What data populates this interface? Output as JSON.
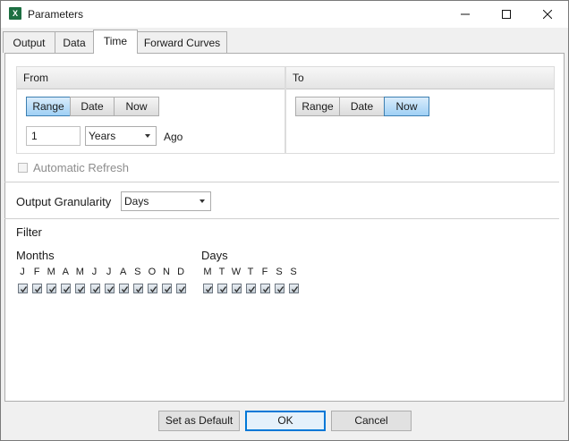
{
  "window": {
    "title": "Parameters",
    "app_icon": "excel-icon"
  },
  "tabs": [
    "Output",
    "Data",
    "Time",
    "Forward Curves"
  ],
  "active_tab": "Time",
  "from": {
    "header": "From",
    "buttons": [
      "Range",
      "Date",
      "Now"
    ],
    "selected": "Range",
    "amount": "1",
    "unit": "Years",
    "suffix": "Ago"
  },
  "to": {
    "header": "To",
    "buttons": [
      "Range",
      "Date",
      "Now"
    ],
    "selected": "Now"
  },
  "automatic_refresh": {
    "label": "Automatic Refresh",
    "checked": false,
    "enabled": false
  },
  "granularity": {
    "label": "Output Granularity",
    "value": "Days"
  },
  "filter": {
    "title": "Filter",
    "months": {
      "label": "Months",
      "letters": [
        "J",
        "F",
        "M",
        "A",
        "M",
        "J",
        "J",
        "A",
        "S",
        "O",
        "N",
        "D"
      ]
    },
    "days": {
      "label": "Days",
      "letters": [
        "M",
        "T",
        "W",
        "T",
        "F",
        "S",
        "S"
      ]
    }
  },
  "footer": {
    "set_default": "Set as Default",
    "ok": "OK",
    "cancel": "Cancel"
  },
  "colors": {
    "selected_button": "#9fd0f5",
    "excel_green": "#1d6f42",
    "default_button_border": "#0078d7"
  }
}
